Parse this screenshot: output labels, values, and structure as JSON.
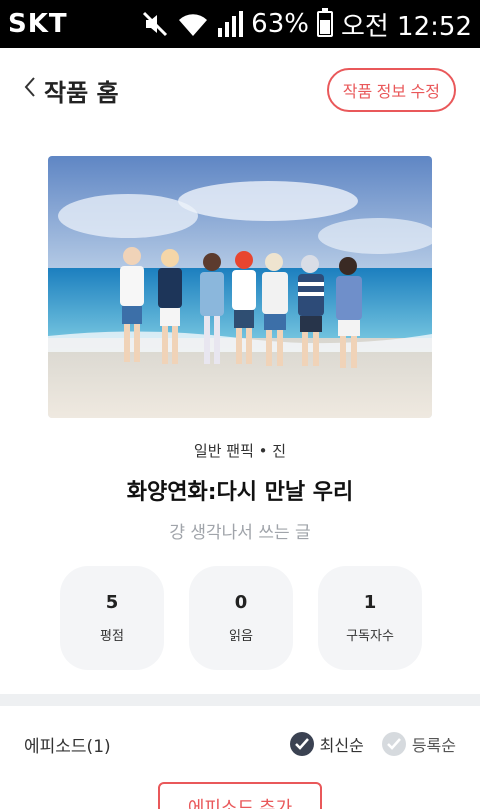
{
  "statusbar": {
    "carrier": "SKT",
    "battery": "63%",
    "battery_level": 0.63,
    "time": "오전 12:52",
    "icons": [
      "mute-icon",
      "wifi-icon",
      "signal-icon",
      "battery-icon"
    ]
  },
  "header": {
    "back_label": "작품 홈",
    "edit_button": "작품 정보 수정"
  },
  "work": {
    "genre": "일반 팬픽 • 진",
    "title": "화양연화:다시 만날 우리",
    "description": "걍 생각나서 쓰는 글"
  },
  "stats": [
    {
      "value": "5",
      "label": "평점"
    },
    {
      "value": "0",
      "label": "읽음"
    },
    {
      "value": "1",
      "label": "구독자수"
    }
  ],
  "episodes": {
    "title": "에피소드(1)",
    "sort_latest": "최신순",
    "sort_registered": "등록순",
    "add_button": "에피소드 추가"
  },
  "colors": {
    "accent": "#e9585a",
    "stat_bg": "#f4f5f7",
    "checked": "#3b4252"
  }
}
